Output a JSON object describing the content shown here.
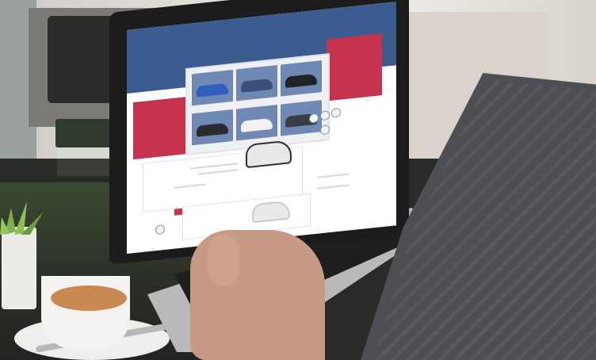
{
  "scene": {
    "description_colors": {
      "website_header": "#3c5b8e",
      "website_accent": "#c5344c",
      "coffee": "#c98a52",
      "sleeve": "#4d4f55"
    }
  },
  "website": {
    "header_title": "",
    "header_subtitle": "",
    "nav_items": [
      "",
      "",
      ""
    ],
    "hero_title": "",
    "gallery_car_colors": [
      "#2f5fbf",
      "#3d4e7a",
      "#1f2326",
      "#2a2c30",
      "#f2f2f2",
      "#3a3d42"
    ]
  }
}
